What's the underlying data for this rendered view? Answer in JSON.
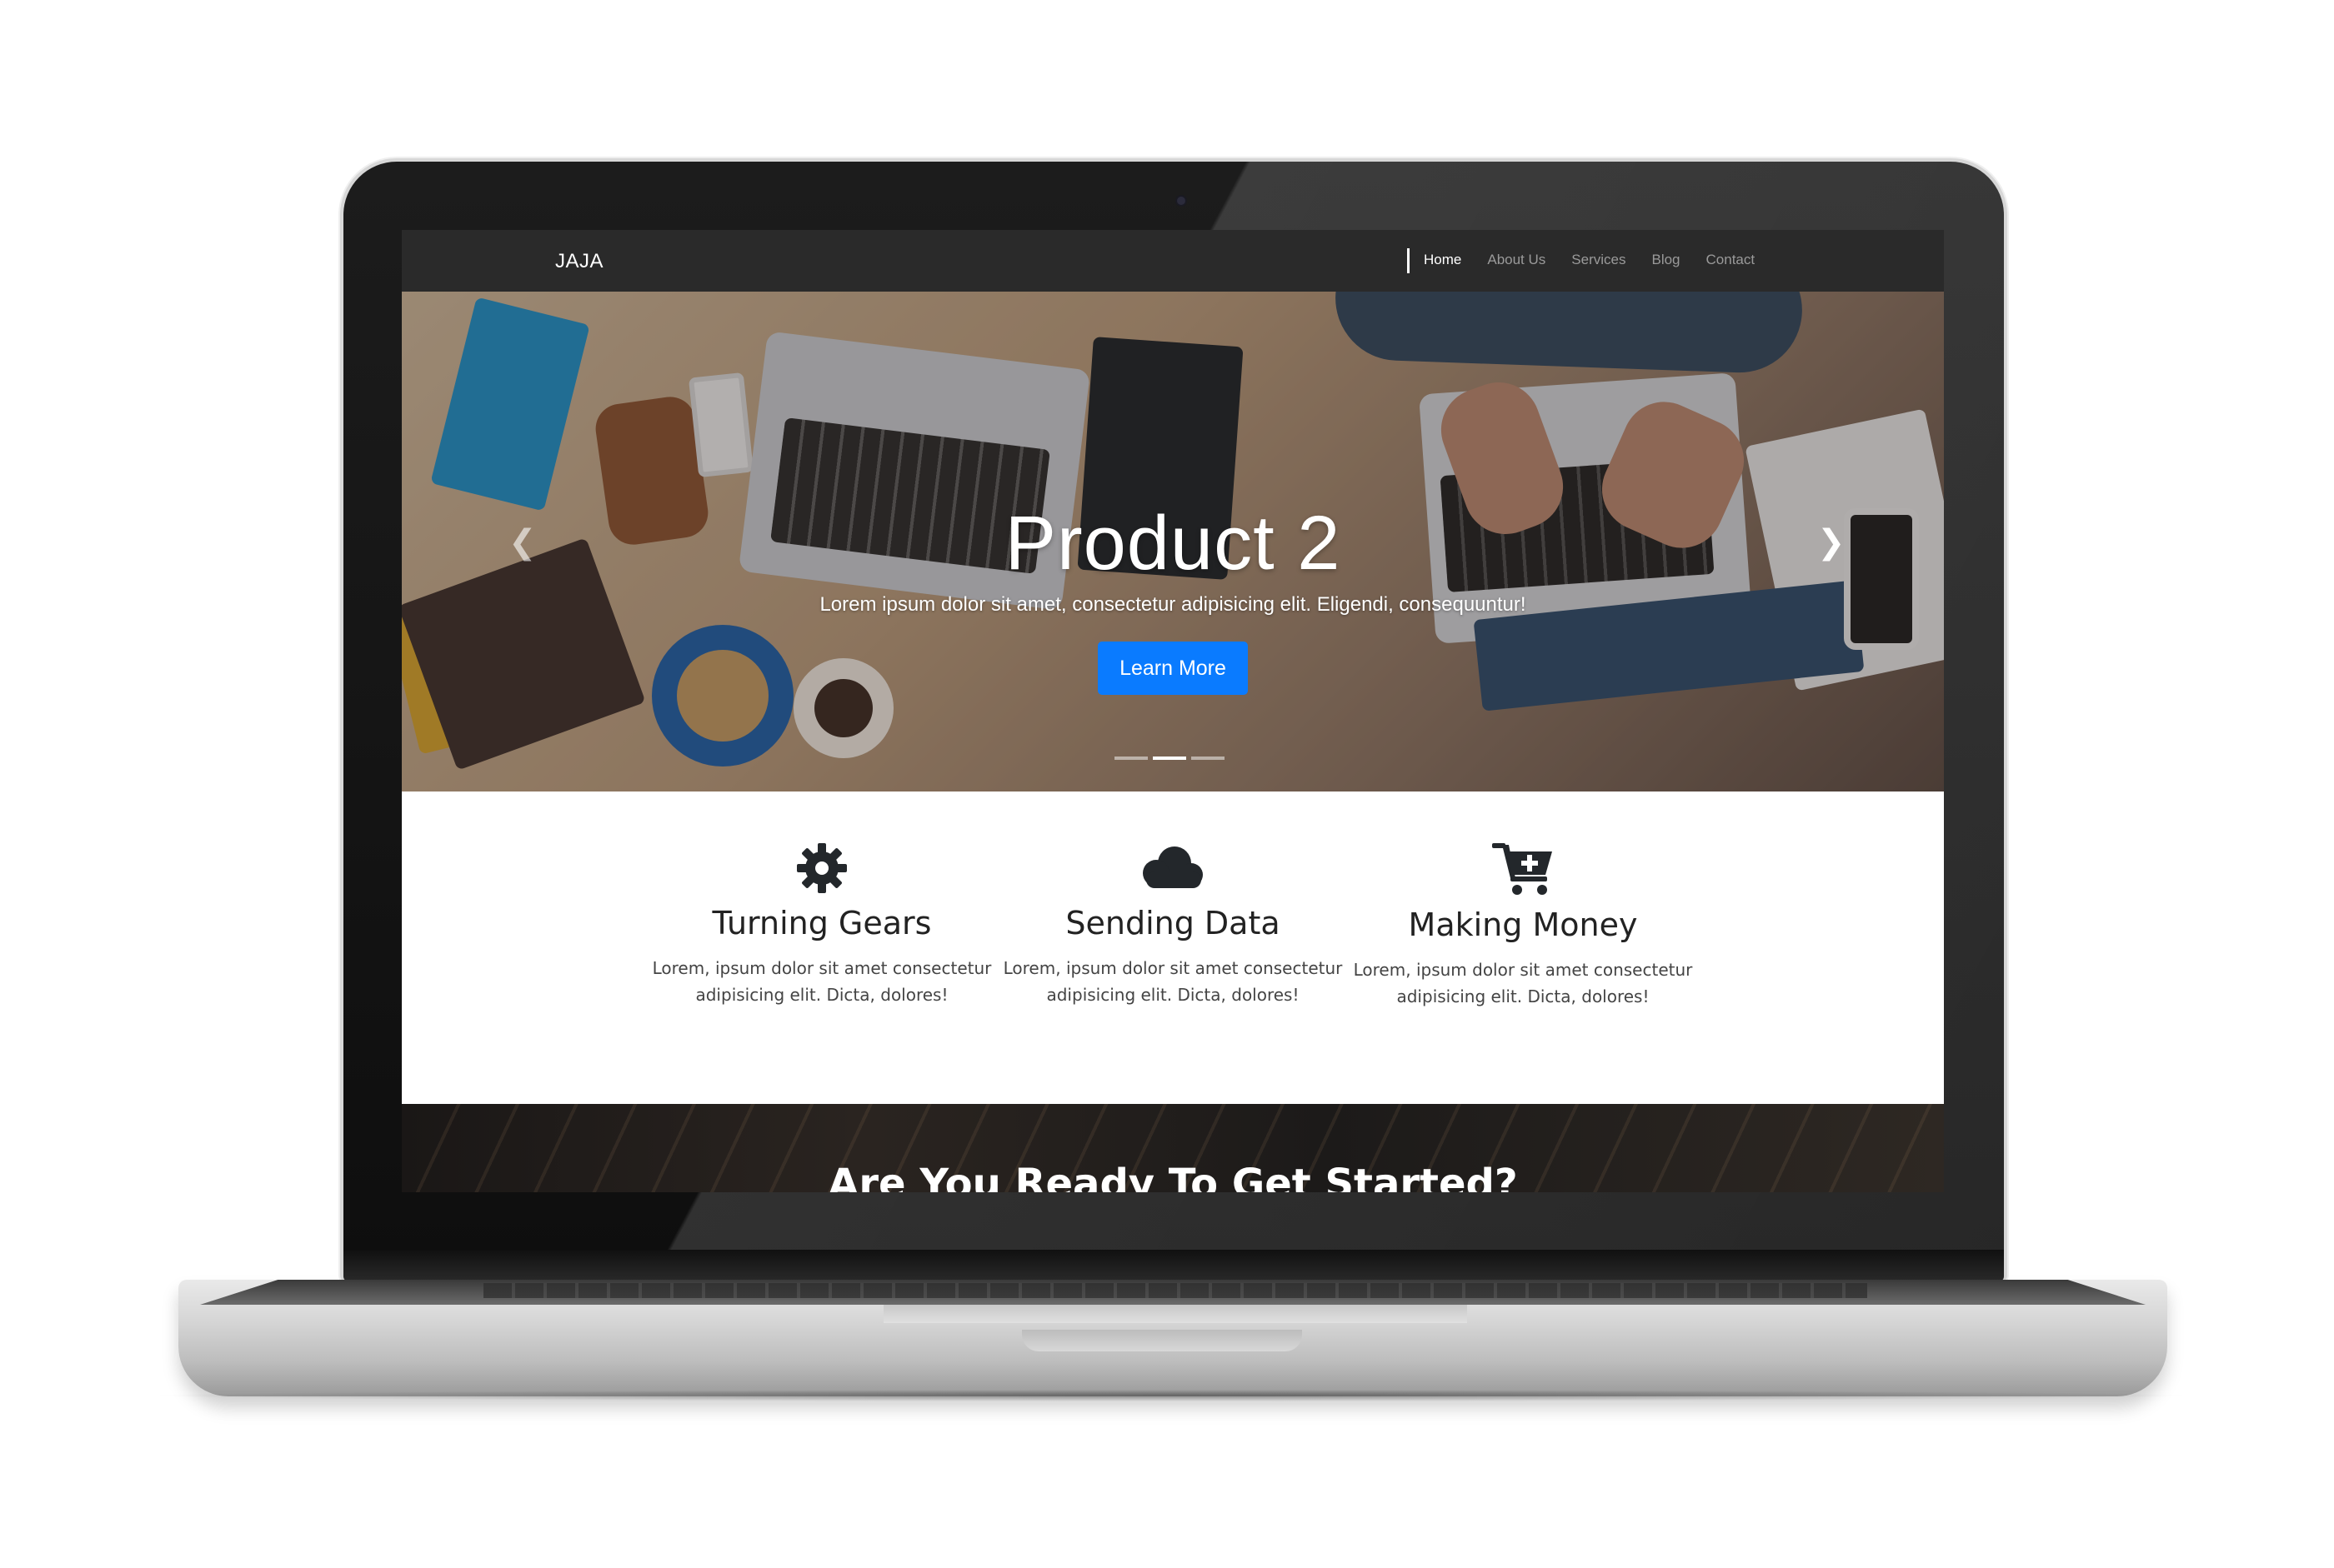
{
  "navbar": {
    "brand": "JAJA",
    "links": [
      "Home",
      "About Us",
      "Services",
      "Blog",
      "Contact"
    ],
    "active_link": "Home"
  },
  "hero": {
    "title": "Product 2",
    "subtitle": "Lorem ipsum dolor sit amet, consectetur adipisicing elit. Eligendi, consequuntur!",
    "button_label": "Learn More",
    "prev_icon": "chevron-left-icon",
    "next_icon": "chevron-right-icon",
    "slide_count": 3,
    "active_slide": 2
  },
  "features": [
    {
      "icon": "gear-icon",
      "title": "Turning Gears",
      "text": "Lorem, ipsum dolor sit amet consectetur adipisicing elit. Dicta, dolores!"
    },
    {
      "icon": "cloud-icon",
      "title": "Sending Data",
      "text": "Lorem, ipsum dolor sit amet consectetur adipisicing elit. Dicta, dolores!"
    },
    {
      "icon": "cart-plus-icon",
      "title": "Making Money",
      "text": "Lorem, ipsum dolor sit amet consectetur adipisicing elit. Dicta, dolores!"
    }
  ],
  "cta": {
    "title": "Are You Ready To Get Started?"
  },
  "colors": {
    "navbar_bg": "#2a2a2a",
    "primary_button": "#0a7bff",
    "icon_color": "#23272b"
  }
}
